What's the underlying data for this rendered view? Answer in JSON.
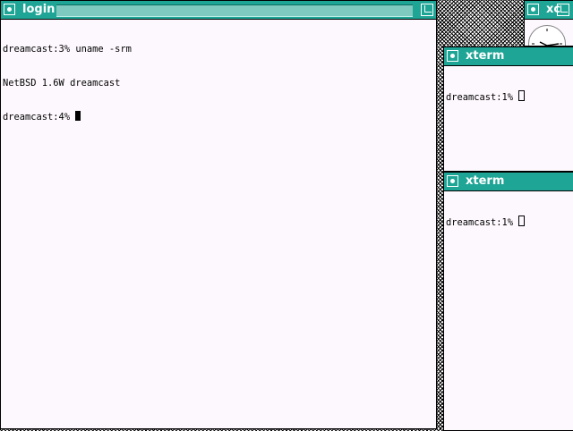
{
  "windows": {
    "login": {
      "title": "login",
      "lines": [
        "dreamcast:3% uname -srm",
        "NetBSD 1.6W dreamcast",
        "dreamcast:4% "
      ]
    },
    "clock": {
      "title": "xc"
    },
    "xterm1": {
      "title": "xterm",
      "lines": [
        "dreamcast:1% "
      ]
    },
    "xterm2": {
      "title": "xterm",
      "lines": [
        "dreamcast:1% "
      ]
    }
  },
  "colors": {
    "titlebar": "#1fa596",
    "window_bg": "#fdf8fd"
  },
  "icons": [
    "iconify-icon",
    "resize-icon",
    "clock-icon"
  ]
}
